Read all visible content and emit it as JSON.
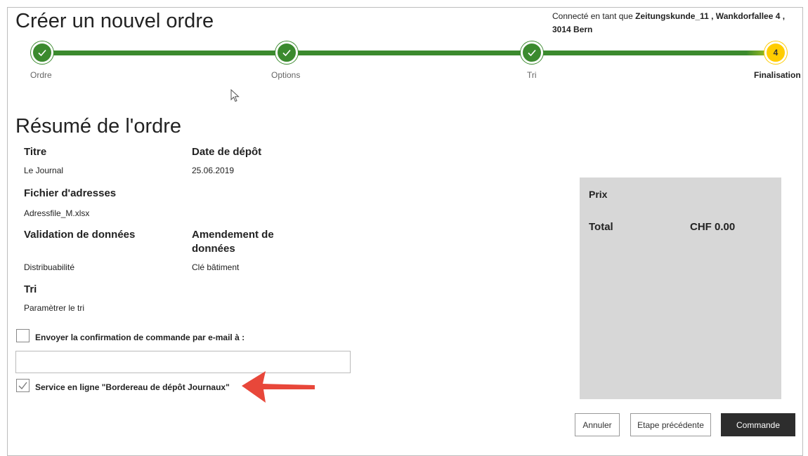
{
  "header": {
    "title": "Créer un nouvel ordre",
    "user_prefix": "Connecté en tant que",
    "user_name": "Zeitungskunde_11 , Wankdorfallee 4 ,",
    "user_address": "3014 Bern"
  },
  "stepper": {
    "steps": [
      {
        "label": "Ordre",
        "status": "done"
      },
      {
        "label": "Options",
        "status": "done"
      },
      {
        "label": "Tri",
        "status": "done"
      },
      {
        "label": "Finalisation",
        "status": "current",
        "number": "4"
      }
    ],
    "colors": {
      "done": "#3b8a2e",
      "current": "#ffcc00"
    }
  },
  "summary": {
    "title": "Résumé de l'ordre",
    "fields": {
      "titre_label": "Titre",
      "titre_value": "Le Journal",
      "date_label": "Date de dépôt",
      "date_value": "25.06.2019",
      "fichier_label": "Fichier d'adresses",
      "fichier_value": "Adressfile_M.xlsx",
      "validation_label": "Validation de données",
      "validation_value": "Distribuabilité",
      "amendement_label": "Amendement de données",
      "amendement_value": "Clé bâtiment",
      "tri_label": "Tri",
      "tri_value": "Paramètrer le tri"
    }
  },
  "options": {
    "email_confirm_label": "Envoyer la confirmation de commande par e-mail à :",
    "email_confirm_checked": false,
    "email_value": "",
    "service_label": "Service en ligne \"Bordereau de dépôt Journaux\"",
    "service_checked": true
  },
  "price": {
    "title": "Prix",
    "total_label": "Total",
    "total_value": "CHF 0.00"
  },
  "buttons": {
    "cancel": "Annuler",
    "previous": "Etape précédente",
    "order": "Commande"
  },
  "colors": {
    "annotation_arrow": "#e8473a",
    "primary_button": "#2d2d2d",
    "price_panel": "#d7d7d7"
  }
}
